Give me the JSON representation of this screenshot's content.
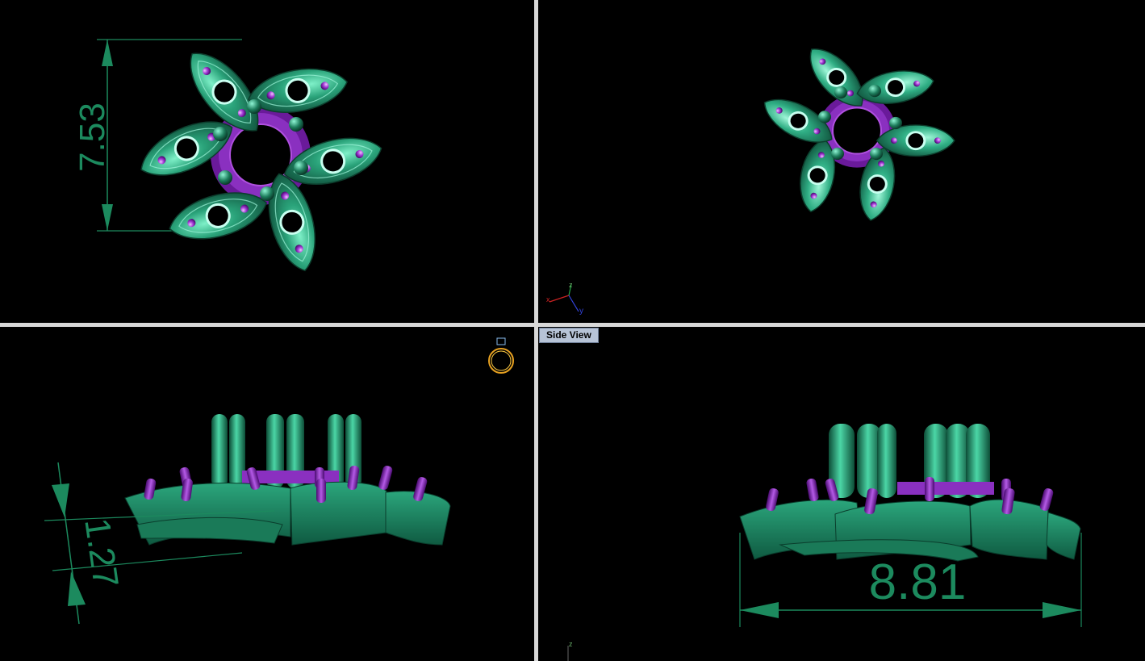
{
  "viewports": {
    "top_left": {
      "dimension_value": "7.53"
    },
    "top_right": {
      "axis_labels": {
        "x": "x",
        "y": "y",
        "z": "z"
      }
    },
    "bottom_left": {
      "dimension_value": "1.27"
    },
    "bottom_right": {
      "label": "Side View",
      "dimension_value": "8.81",
      "axis_label_z": "z"
    }
  },
  "colors": {
    "background": "#000000",
    "metal_green": "#1f8a64",
    "metal_green_light": "#5fd8b2",
    "gem_purple": "#7a1fb0",
    "dimension": "#1c8a5e",
    "divider": "#d8d8d8",
    "label_bg": "#b7c3d6"
  },
  "icons": [
    "axis-triad-icon",
    "ring-view-icon"
  ]
}
